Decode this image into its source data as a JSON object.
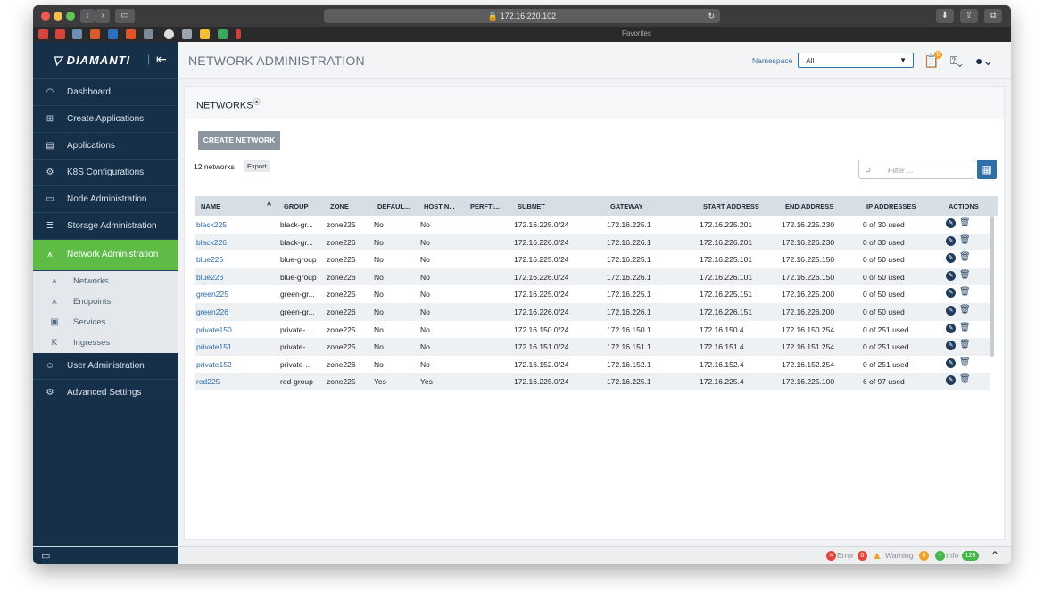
{
  "browser": {
    "url": "172.16.220.102",
    "favorites_label": "Favorites"
  },
  "brand": {
    "name": "DIAMANTI"
  },
  "sidebar": {
    "items": [
      {
        "label": "Dashboard",
        "icon": "gauge-icon"
      },
      {
        "label": "Create Applications",
        "icon": "plus-box-icon"
      },
      {
        "label": "Applications",
        "icon": "list-box-icon"
      },
      {
        "label": "K8S Configurations",
        "icon": "k8s-gear-icon"
      },
      {
        "label": "Node Administration",
        "icon": "server-icon"
      },
      {
        "label": "Storage Administration",
        "icon": "database-icon"
      },
      {
        "label": "Network Administration",
        "icon": "network-icon",
        "active": true
      },
      {
        "label": "User Administration",
        "icon": "users-icon"
      },
      {
        "label": "Advanced Settings",
        "icon": "settings-icon"
      }
    ],
    "subitems": [
      {
        "label": "Networks",
        "icon": "network-icon"
      },
      {
        "label": "Endpoints",
        "icon": "endpoints-icon"
      },
      {
        "label": "Services",
        "icon": "services-icon"
      },
      {
        "label": "Ingresses",
        "icon": "ingress-icon"
      }
    ]
  },
  "header": {
    "title": "NETWORK ADMINISTRATION",
    "namespace_label": "Namespace",
    "namespace_value": "All",
    "notification_count": "0"
  },
  "networks": {
    "title": "NETWORKS",
    "create_label": "CREATE NETWORK",
    "count_label": "12 networks",
    "export_label": "Export",
    "filter_placeholder": "Filter ..."
  },
  "table": {
    "columns": [
      "NAME",
      "GROUP",
      "ZONE",
      "DEFAUL...",
      "HOST N...",
      "PERFTI...",
      "SUBNET",
      "GATEWAY",
      "START ADDRESS",
      "END ADDRESS",
      "IP ADDRESSES",
      "ACTIONS"
    ],
    "rows": [
      {
        "name": "black225",
        "group": "black-gr...",
        "zone": "zone225",
        "default": "No",
        "host": "No",
        "perf": "",
        "subnet": "172.16.225.0/24",
        "gateway": "172.16.225.1",
        "start": "172.16.225.201",
        "end": "172.16.225.230",
        "ips": "0 of 30 used"
      },
      {
        "name": "black226",
        "group": "black-gr...",
        "zone": "zone226",
        "default": "No",
        "host": "No",
        "perf": "",
        "subnet": "172.16.226.0/24",
        "gateway": "172.16.226.1",
        "start": "172.16.226.201",
        "end": "172.16.226.230",
        "ips": "0 of 30 used"
      },
      {
        "name": "blue225",
        "group": "blue-group",
        "zone": "zone225",
        "default": "No",
        "host": "No",
        "perf": "",
        "subnet": "172.16.225.0/24",
        "gateway": "172.16.225.1",
        "start": "172.16.225.101",
        "end": "172.16.225.150",
        "ips": "0 of 50 used"
      },
      {
        "name": "blue226",
        "group": "blue-group",
        "zone": "zone226",
        "default": "No",
        "host": "No",
        "perf": "",
        "subnet": "172.16.226.0/24",
        "gateway": "172.16.226.1",
        "start": "172.16.226.101",
        "end": "172.16.226.150",
        "ips": "0 of 50 used"
      },
      {
        "name": "green225",
        "group": "green-gr...",
        "zone": "zone225",
        "default": "No",
        "host": "No",
        "perf": "",
        "subnet": "172.16.225.0/24",
        "gateway": "172.16.225.1",
        "start": "172.16.225.151",
        "end": "172.16.225.200",
        "ips": "0 of 50 used"
      },
      {
        "name": "green226",
        "group": "green-gr...",
        "zone": "zone226",
        "default": "No",
        "host": "No",
        "perf": "",
        "subnet": "172.16.226.0/24",
        "gateway": "172.16.226.1",
        "start": "172.16.226.151",
        "end": "172.16.226.200",
        "ips": "0 of 50 used"
      },
      {
        "name": "private150",
        "group": "private-...",
        "zone": "zone225",
        "default": "No",
        "host": "No",
        "perf": "",
        "subnet": "172.16.150.0/24",
        "gateway": "172.16.150.1",
        "start": "172.16.150.4",
        "end": "172.16.150.254",
        "ips": "0 of 251 used"
      },
      {
        "name": "private151",
        "group": "private-...",
        "zone": "zone225",
        "default": "No",
        "host": "No",
        "perf": "",
        "subnet": "172.16.151.0/24",
        "gateway": "172.16.151.1",
        "start": "172.16.151.4",
        "end": "172.16.151.254",
        "ips": "0 of 251 used"
      },
      {
        "name": "private152",
        "group": "private-...",
        "zone": "zone226",
        "default": "No",
        "host": "No",
        "perf": "",
        "subnet": "172.16.152.0/24",
        "gateway": "172.16.152.1",
        "start": "172.16.152.4",
        "end": "172.16.152.254",
        "ips": "0 of 251 used"
      },
      {
        "name": "red225",
        "group": "red-group",
        "zone": "zone225",
        "default": "Yes",
        "host": "Yes",
        "perf": "",
        "subnet": "172.16.225.0/24",
        "gateway": "172.16.225.1",
        "start": "172.16.225.4",
        "end": "172.16.225.100",
        "ips": "6 of 97 used"
      }
    ]
  },
  "status": {
    "error_label": "Error",
    "error_count": "0",
    "warning_label": "Warning",
    "warning_count": "0",
    "info_label": "Info",
    "info_count": "129"
  },
  "colors": {
    "sidebar_bg": "#16304a",
    "active_green": "#5dbb46",
    "link_blue": "#2c6aa8",
    "error_red": "#e0473a",
    "warning_orange": "#f0a12c",
    "info_green": "#45b649"
  }
}
